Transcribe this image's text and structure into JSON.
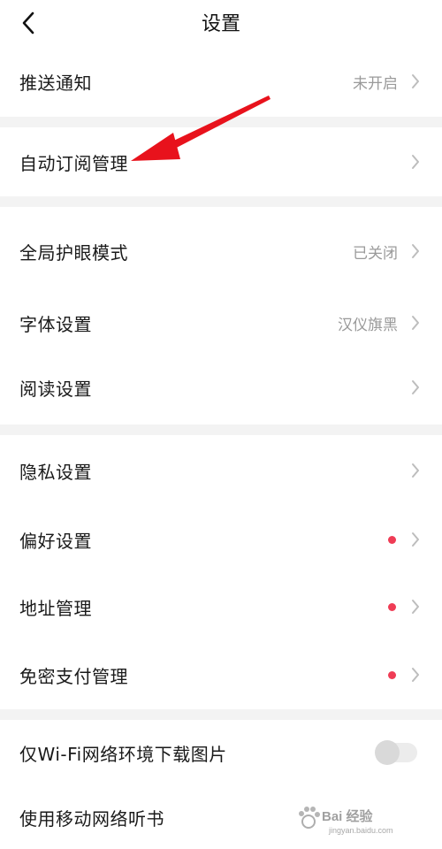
{
  "header": {
    "title": "设置"
  },
  "sections": {
    "push": {
      "label": "推送通知",
      "value": "未开启"
    },
    "auto_subscribe": {
      "label": "自动订阅管理"
    },
    "eye_mode": {
      "label": "全局护眼模式",
      "value": "已关闭"
    },
    "font": {
      "label": "字体设置",
      "value": "汉仪旗黑"
    },
    "reading": {
      "label": "阅读设置"
    },
    "privacy": {
      "label": "隐私设置"
    },
    "preference": {
      "label": "偏好设置"
    },
    "address": {
      "label": "地址管理"
    },
    "password_free": {
      "label": "免密支付管理"
    },
    "wifi_images": {
      "label": "仅Wi-Fi网络环境下载图片",
      "enabled": false
    },
    "mobile_listen": {
      "label": "使用移动网络听书"
    }
  },
  "watermark": {
    "text": "Bai 经验",
    "sub": "jingyan.baidu.com"
  },
  "colors": {
    "red_dot": "#ef3c55",
    "arrow": "#e8121c",
    "divider": "#f3f3f3"
  }
}
